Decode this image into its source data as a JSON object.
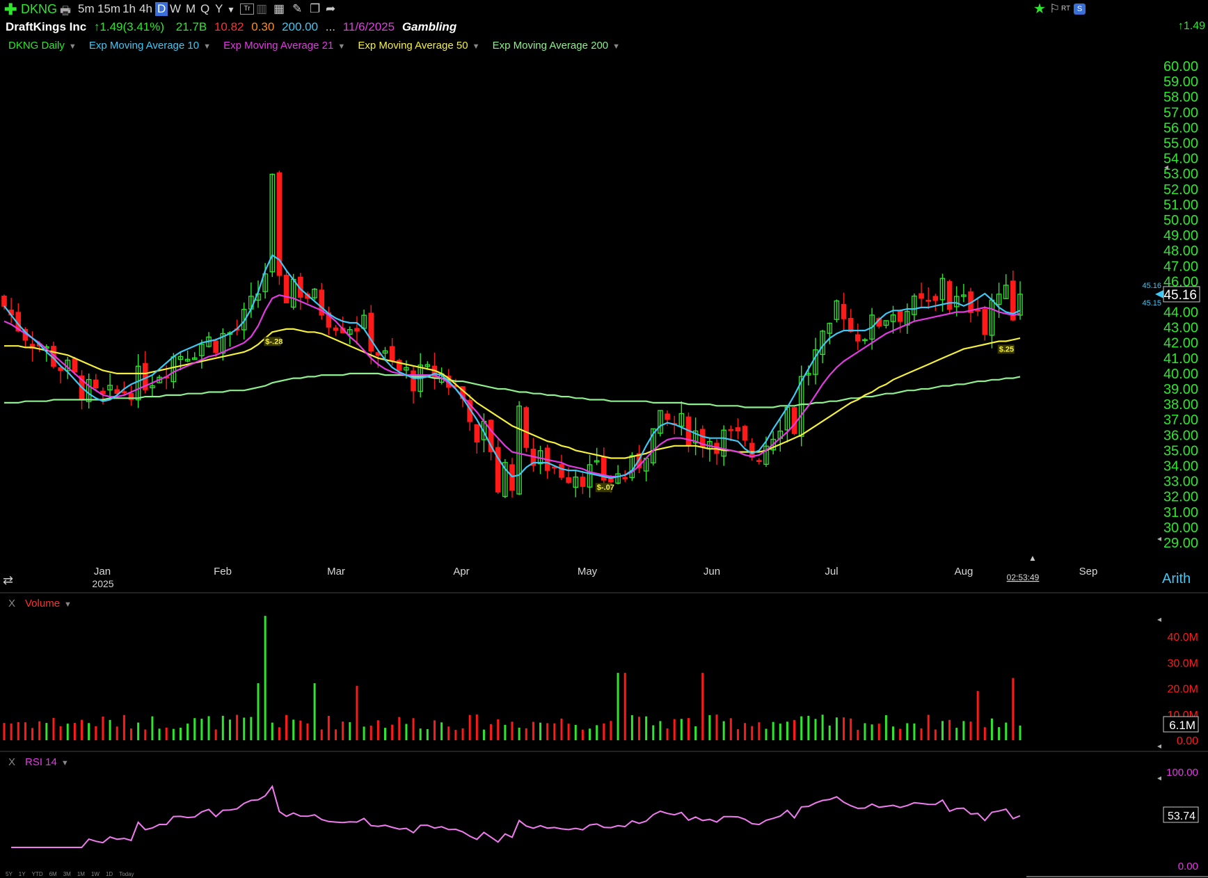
{
  "toolbar": {
    "symbol": "DKNG",
    "intervals": [
      "5m",
      "15m",
      "1h",
      "4h",
      "D",
      "W",
      "M",
      "Q",
      "Y"
    ],
    "selected_interval": "D",
    "rt_label": "RT",
    "right_value": "1.49"
  },
  "info": {
    "company": "DraftKings Inc",
    "change": "1.49",
    "change_pct": "(3.41%)",
    "market_cap": "21.7B",
    "v1": "10.82",
    "v2": "0.30",
    "v3": "200.00",
    "ellipsis": "...",
    "date": "11/6/2025",
    "industry": "Gambling"
  },
  "legend": {
    "series": [
      "DKNG Daily",
      "Exp Moving Average 10",
      "Exp Moving Average 21",
      "Exp Moving Average 50",
      "Exp Moving Average 200"
    ],
    "colors": [
      "#2ee62e",
      "#3ec8f5",
      "#e23be2",
      "#f5f03c",
      "#8ef08e"
    ]
  },
  "price_axis": {
    "ticks": [
      "60.00",
      "59.00",
      "58.00",
      "57.00",
      "56.00",
      "55.00",
      "54.00",
      "53.00",
      "52.00",
      "51.00",
      "50.00",
      "49.00",
      "48.00",
      "47.00",
      "46.00",
      "45.00",
      "44.00",
      "43.00",
      "42.00",
      "41.00",
      "40.00",
      "39.00",
      "38.00",
      "37.00",
      "36.00",
      "35.00",
      "34.00",
      "33.00",
      "32.00",
      "31.00",
      "30.00",
      "29.00"
    ],
    "last_price": "45.16",
    "ema10_label": "45.16",
    "ema21_label": "45.15",
    "scale_label": "Arith"
  },
  "time_axis": {
    "months": [
      "Jan",
      "Feb",
      "Mar",
      "Apr",
      "May",
      "Jun",
      "Jul",
      "Aug",
      "Sep"
    ],
    "year": "2025",
    "countdown": "02:53:49"
  },
  "dividend_flags": [
    "$-.28",
    "$-.07",
    "$.25"
  ],
  "volume_panel": {
    "title": "Volume",
    "close_label": "X",
    "ticks": [
      "40.0M",
      "30.0M",
      "20.0M",
      "10.0M",
      "0.00"
    ],
    "last": "6.1M"
  },
  "rsi_panel": {
    "title": "RSI 14",
    "close_label": "X",
    "ticks": [
      "100.00",
      "0.00"
    ],
    "last": "53.74"
  },
  "ranges": [
    "5Y",
    "1Y",
    "YTD",
    "6M",
    "3M",
    "1M",
    "1W",
    "1D",
    "Today"
  ],
  "chart_data": {
    "type": "candlestick",
    "ylim": [
      29,
      60
    ],
    "series": [
      {
        "name": "DKNG Daily",
        "type": "ohlc",
        "open": [],
        "high": [],
        "low": [],
        "close": []
      },
      {
        "name": "Exp Moving Average 10",
        "values": [
          44.4,
          43.8,
          43.2,
          42.7,
          42.3,
          41.9,
          41.4,
          41.0,
          40.5,
          40.1,
          39.6,
          39.1,
          38.7,
          38.4,
          38.2,
          38.3,
          38.6,
          39.0,
          39.3,
          39.5,
          39.7,
          39.9,
          40.3,
          40.7,
          41.1,
          41.4,
          41.6,
          41.8,
          42.0,
          42.1,
          42.2,
          42.4,
          42.6,
          42.9,
          43.4,
          44.2,
          45.3,
          46.7,
          47.7,
          47.4,
          46.7,
          46.1,
          45.5,
          45.1,
          44.7,
          44.3,
          43.9,
          43.6,
          43.4,
          43.3,
          43.3,
          42.9,
          42.2,
          41.5,
          40.9,
          40.4,
          40.1,
          39.9,
          39.7,
          39.7,
          39.8,
          40.0,
          39.9,
          39.5,
          39.0,
          38.4,
          37.7,
          37.0,
          36.2,
          35.3,
          34.5,
          33.8,
          33.3,
          33.4,
          33.9,
          34.2,
          34.2,
          34.2,
          34.0,
          33.8,
          33.7,
          33.7,
          33.6,
          33.5,
          33.4,
          33.3,
          33.2,
          33.3,
          33.4,
          33.7,
          34.4,
          35.3,
          36.1,
          36.6,
          36.8,
          36.7,
          36.5,
          36.3,
          36.1,
          35.9,
          35.8,
          35.8,
          35.8,
          35.7,
          35.6,
          35.1,
          34.8,
          35.0,
          35.6,
          36.4,
          37.1,
          37.8,
          38.6,
          39.5,
          40.3,
          41.1,
          41.8,
          42.3,
          42.6,
          42.8,
          42.8,
          42.8,
          42.8,
          43.0,
          43.5,
          43.9,
          44.1,
          44.1,
          44.2,
          44.2,
          44.3,
          44.3,
          44.4,
          44.5,
          44.6,
          44.6,
          44.4,
          44.6,
          44.9,
          45.2,
          44.8,
          44.3,
          44.0,
          43.9,
          44.1
        ]
      },
      {
        "name": "Exp Moving Average 21",
        "values": [
          43.4,
          43.2,
          42.9,
          42.6,
          42.3,
          42.0,
          41.6,
          41.2,
          40.8,
          40.4,
          40.0,
          39.6,
          39.2,
          38.9,
          38.6,
          38.5,
          38.5,
          38.6,
          38.8,
          39.0,
          39.2,
          39.4,
          39.6,
          39.8,
          40.1,
          40.3,
          40.5,
          40.7,
          40.9,
          41.1,
          41.2,
          41.4,
          41.6,
          41.8,
          42.0,
          42.4,
          43.1,
          44.1,
          44.9,
          45.1,
          45.0,
          44.9,
          44.7,
          44.5,
          44.3,
          44.1,
          43.8,
          43.4,
          42.9,
          42.4,
          42.0,
          41.5,
          41.0,
          40.6,
          40.3,
          40.1,
          40.0,
          39.9,
          39.9,
          39.9,
          39.9,
          39.9,
          39.7,
          39.4,
          39.0,
          38.5,
          38.0,
          37.5,
          36.9,
          36.3,
          35.8,
          35.3,
          34.9,
          34.8,
          34.7,
          34.6,
          34.5,
          34.4,
          34.3,
          34.2,
          34.0,
          33.9,
          33.8,
          33.6,
          33.5,
          33.4,
          33.3,
          33.3,
          33.4,
          33.6,
          34.0,
          34.5,
          35.0,
          35.4,
          35.7,
          35.8,
          35.8,
          35.7,
          35.6,
          35.4,
          35.3,
          35.2,
          35.1,
          35.0,
          34.9,
          34.7,
          34.6,
          34.7,
          35.0,
          35.4,
          35.8,
          36.2,
          36.7,
          37.3,
          37.9,
          38.6,
          39.3,
          39.9,
          40.4,
          40.8,
          41.1,
          41.4,
          41.7,
          42.0,
          42.3,
          42.6,
          42.8,
          43.0,
          43.2,
          43.4,
          43.5,
          43.6,
          43.7,
          43.8,
          43.9,
          44.0,
          44.0,
          44.1,
          44.2,
          44.3,
          44.2,
          44.0,
          43.9,
          43.8,
          43.9
        ]
      },
      {
        "name": "Exp Moving Average 50",
        "values": [
          41.8,
          41.8,
          41.8,
          41.7,
          41.7,
          41.6,
          41.5,
          41.4,
          41.3,
          41.2,
          41.0,
          40.8,
          40.6,
          40.4,
          40.2,
          40.1,
          40.0,
          40.0,
          40.0,
          40.0,
          40.0,
          40.1,
          40.2,
          40.3,
          40.4,
          40.5,
          40.6,
          40.7,
          40.8,
          40.9,
          41.0,
          41.1,
          41.2,
          41.3,
          41.4,
          41.6,
          41.9,
          42.3,
          42.7,
          42.8,
          42.9,
          42.9,
          42.8,
          42.7,
          42.7,
          42.6,
          42.4,
          42.2,
          42.0,
          41.8,
          41.6,
          41.4,
          41.2,
          41.0,
          40.9,
          40.8,
          40.7,
          40.6,
          40.5,
          40.4,
          40.3,
          40.2,
          40.0,
          39.7,
          39.3,
          38.9,
          38.5,
          38.1,
          37.8,
          37.5,
          37.2,
          36.9,
          36.6,
          36.4,
          36.2,
          36.0,
          35.8,
          35.6,
          35.5,
          35.3,
          35.2,
          35.0,
          34.9,
          34.8,
          34.7,
          34.6,
          34.5,
          34.5,
          34.5,
          34.6,
          34.7,
          34.8,
          35.0,
          35.1,
          35.2,
          35.3,
          35.3,
          35.3,
          35.3,
          35.2,
          35.1,
          35.1,
          35.0,
          35.0,
          34.9,
          34.9,
          34.9,
          34.9,
          35.0,
          35.2,
          35.4,
          35.6,
          35.8,
          36.0,
          36.3,
          36.6,
          36.9,
          37.2,
          37.5,
          37.8,
          38.1,
          38.3,
          38.6,
          38.8,
          39.1,
          39.3,
          39.6,
          39.8,
          40.0,
          40.2,
          40.4,
          40.6,
          40.8,
          41.0,
          41.2,
          41.4,
          41.6,
          41.7,
          41.8,
          41.9,
          42.0,
          42.1,
          42.1,
          42.2,
          42.3
        ]
      },
      {
        "name": "Exp Moving Average 200",
        "values": [
          38.1,
          38.1,
          38.1,
          38.2,
          38.2,
          38.2,
          38.2,
          38.3,
          38.3,
          38.3,
          38.3,
          38.3,
          38.3,
          38.3,
          38.3,
          38.4,
          38.4,
          38.4,
          38.4,
          38.4,
          38.5,
          38.5,
          38.5,
          38.6,
          38.6,
          38.6,
          38.7,
          38.7,
          38.7,
          38.8,
          38.8,
          38.8,
          38.9,
          38.9,
          38.9,
          39.0,
          39.1,
          39.2,
          39.4,
          39.5,
          39.6,
          39.7,
          39.7,
          39.8,
          39.8,
          39.9,
          39.9,
          39.9,
          39.9,
          40.0,
          40.0,
          40.0,
          40.0,
          40.0,
          39.9,
          39.9,
          39.9,
          39.9,
          39.8,
          39.8,
          39.8,
          39.7,
          39.7,
          39.6,
          39.5,
          39.5,
          39.4,
          39.3,
          39.2,
          39.1,
          39.0,
          39.0,
          38.9,
          38.8,
          38.8,
          38.7,
          38.7,
          38.6,
          38.6,
          38.5,
          38.5,
          38.4,
          38.4,
          38.3,
          38.3,
          38.3,
          38.2,
          38.2,
          38.2,
          38.2,
          38.2,
          38.2,
          38.1,
          38.1,
          38.1,
          38.1,
          38.1,
          38.0,
          38.0,
          38.0,
          38.0,
          37.9,
          37.9,
          37.9,
          37.9,
          37.8,
          37.8,
          37.8,
          37.8,
          37.8,
          37.9,
          37.9,
          37.9,
          38.0,
          38.0,
          38.1,
          38.1,
          38.2,
          38.2,
          38.3,
          38.4,
          38.4,
          38.5,
          38.5,
          38.6,
          38.7,
          38.7,
          38.8,
          38.9,
          38.9,
          39.0,
          39.0,
          39.1,
          39.2,
          39.2,
          39.3,
          39.3,
          39.4,
          39.5,
          39.5,
          39.6,
          39.6,
          39.7,
          39.7,
          39.8
        ]
      }
    ],
    "volume_M": [],
    "rsi": []
  }
}
